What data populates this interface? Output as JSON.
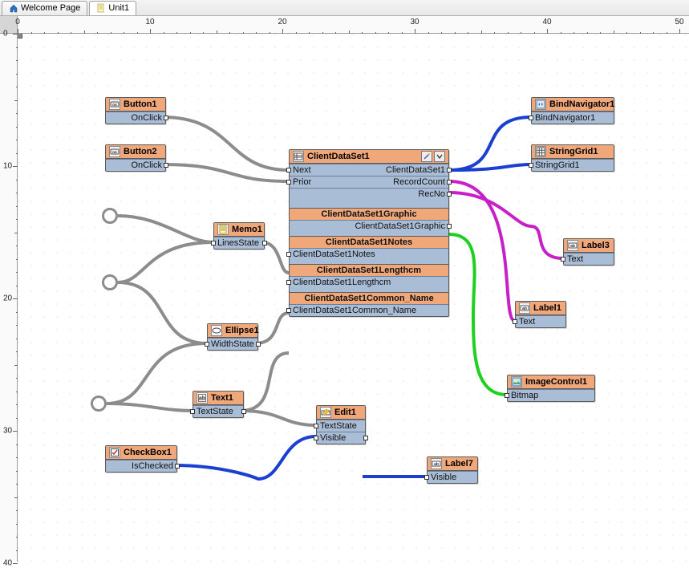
{
  "tabs": [
    {
      "label": "Welcome Page",
      "active": false
    },
    {
      "label": "Unit1",
      "active": true
    }
  ],
  "ruler": {
    "h_max": 50,
    "v_max": 40,
    "major": 10
  },
  "nodes": {
    "button1": {
      "title": "Button1",
      "rows": [
        "OnClick"
      ]
    },
    "button2": {
      "title": "Button2",
      "rows": [
        "OnClick"
      ]
    },
    "memo1": {
      "title": "Memo1",
      "rows": [
        "LinesState"
      ]
    },
    "ellipse1": {
      "title": "Ellipse1",
      "rows": [
        "WidthState"
      ]
    },
    "text1": {
      "title": "Text1",
      "rows": [
        "TextState"
      ]
    },
    "checkbox1": {
      "title": "CheckBox1",
      "rows": [
        "IsChecked"
      ]
    },
    "edit1": {
      "title": "Edit1",
      "rows": [
        "TextState",
        "Visible"
      ]
    },
    "label7": {
      "title": "Label7",
      "rows": [
        "Visible"
      ]
    },
    "bindnav1": {
      "title": "BindNavigator1",
      "rows": [
        "BindNavigator1"
      ]
    },
    "stringgrid1": {
      "title": "StringGrid1",
      "rows": [
        "StringGrid1"
      ]
    },
    "label3": {
      "title": "Label3",
      "rows": [
        "Text"
      ]
    },
    "label1": {
      "title": "Label1",
      "rows": [
        "Text"
      ]
    },
    "imagecontrol1": {
      "title": "ImageControl1",
      "rows": [
        "Bitmap"
      ]
    },
    "cds": {
      "title": "ClientDataSet1",
      "left": [
        "Next",
        "Prior"
      ],
      "right": [
        "ClientDataSet1",
        "RecordCount",
        "RecNo"
      ],
      "sections": [
        {
          "header": "ClientDataSet1Graphic",
          "row": "ClientDataSet1Graphic"
        },
        {
          "header": "ClientDataSet1Notes",
          "row": "ClientDataSet1Notes"
        },
        {
          "header": "ClientDataSet1Lengthcm",
          "row": "ClientDataSet1Lengthcm"
        },
        {
          "header": "ClientDataSet1Common_Name",
          "row": "ClientDataSet1Common_Name"
        }
      ]
    }
  },
  "colors": {
    "gray": "#8c8c8c",
    "blue": "#1a3fd1",
    "magenta": "#c820c8",
    "green": "#1fd01f"
  }
}
